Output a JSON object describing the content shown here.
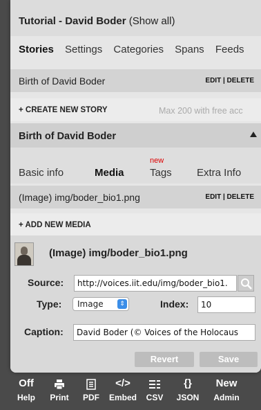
{
  "header": {
    "title_bold": "Tutorial - David Boder",
    "title_paren": " (Show all)"
  },
  "tabs": [
    "Stories",
    "Settings",
    "Categories",
    "Spans",
    "Feeds"
  ],
  "story_row": {
    "label": "Birth of David Boder",
    "actions": "EDIT | DELETE"
  },
  "create_story": {
    "label": "+ CREATE NEW STORY",
    "note": "Max 200 with free acc"
  },
  "story_section": {
    "title": "Birth of David Boder"
  },
  "sub_tabs": {
    "basic": "Basic info",
    "media": "Media",
    "tags": "Tags",
    "tags_badge": "new",
    "extra": "Extra Info"
  },
  "media_row": {
    "label": "(Image) img/boder_bio1.png",
    "actions": "EDIT | DELETE"
  },
  "add_media": {
    "label": "+ ADD NEW MEDIA"
  },
  "media_card": {
    "title": "(Image) img/boder_bio1.png",
    "source_label": "Source:",
    "source_value": "http://voices.iit.edu/img/boder_bio1.",
    "type_label": "Type:",
    "type_value": "Image",
    "index_label": "Index:",
    "index_value": "10",
    "caption_label": "Caption:",
    "caption_value": "David Boder (© Voices of the Holocaus",
    "revert": "Revert",
    "save": "Save"
  },
  "toolbar": [
    {
      "icon": "Off",
      "label": "Help"
    },
    {
      "icon": "print-icon",
      "label": "Print"
    },
    {
      "icon": "pdf-icon",
      "label": "PDF"
    },
    {
      "icon": "</>",
      "label": "Embed"
    },
    {
      "icon": "csv-icon",
      "label": "CSV"
    },
    {
      "icon": "{}",
      "label": "JSON"
    },
    {
      "icon": "New",
      "label": "Admin"
    }
  ]
}
